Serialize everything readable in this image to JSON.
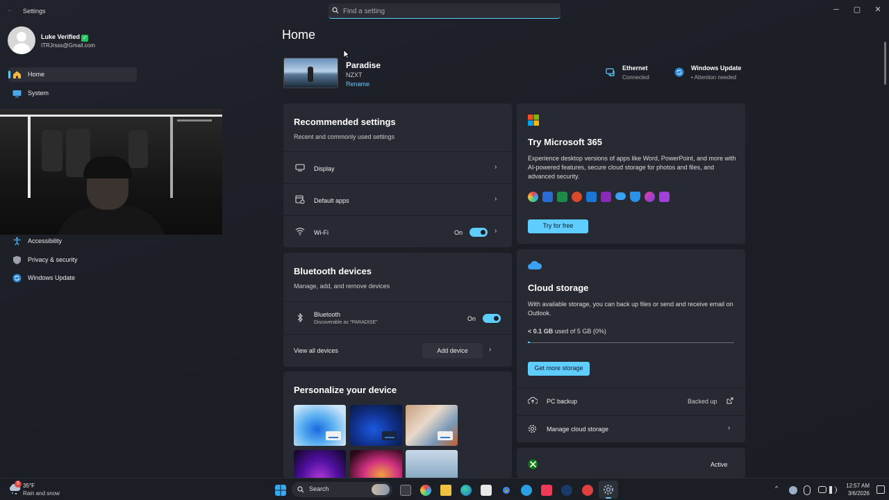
{
  "window": {
    "title": "Settings",
    "minimize_glyph": "─",
    "maximize_glyph": "▢",
    "close_glyph": "✕"
  },
  "search": {
    "placeholder": "Find a setting"
  },
  "user": {
    "name": "Luke Verified",
    "email": "ITRJrsss@Gmail.com",
    "verified_glyph": "✓"
  },
  "sidebar": {
    "items": [
      {
        "label": "Home",
        "icon": "home-icon"
      },
      {
        "label": "System",
        "icon": "system-icon"
      },
      {
        "label": "Accessibility",
        "icon": "accessibility-icon"
      },
      {
        "label": "Privacy & security",
        "icon": "shield-icon"
      },
      {
        "label": "Windows Update",
        "icon": "update-icon"
      }
    ]
  },
  "main": {
    "title": "Home",
    "device": {
      "name": "Paradise",
      "model": "NZXT",
      "rename_label": "Rename"
    },
    "status": {
      "ethernet": {
        "title": "Ethernet",
        "sub": "Connected"
      },
      "update": {
        "title": "Windows Update",
        "sub": "Attention needed"
      }
    },
    "recommended": {
      "title": "Recommended settings",
      "subtitle": "Recent and commonly used settings",
      "rows": [
        {
          "label": "Display",
          "icon": "monitor-icon"
        },
        {
          "label": "Default apps",
          "icon": "default-apps-icon"
        },
        {
          "label": "Wi-Fi",
          "icon": "wifi-icon",
          "state": "On"
        }
      ]
    },
    "bluetooth": {
      "title": "Bluetooth devices",
      "subtitle": "Manage, add, and remove devices",
      "row_title": "Bluetooth",
      "row_sub": "Discoverable as \"PARADISE\"",
      "state": "On",
      "view_all": "View all devices",
      "add_device": "Add device"
    },
    "personalize": {
      "title": "Personalize your device"
    },
    "m365": {
      "title": "Try Microsoft 365",
      "body": "Experience desktop versions of apps like Word, PowerPoint, and more with AI-powered features, secure cloud storage for photos and files, and advanced security.",
      "button": "Try for free"
    },
    "cloud": {
      "title": "Cloud storage",
      "body": "With available storage, you can back up files or send and receive email on Outlook.",
      "usage_bold": "< 0.1 GB",
      "usage_rest": "used of 5 GB (0%)",
      "usage_fraction": 0.01,
      "button": "Get more storage",
      "pc_backup_label": "PC backup",
      "pc_backup_status": "Backed up",
      "manage_label": "Manage cloud storage"
    },
    "xbox": {
      "status": "Active"
    }
  },
  "chevron_glyph": "›",
  "taskbar": {
    "search_label": "Search",
    "weather_badge": "5",
    "weather_temp": "35°F",
    "weather_desc": "Rain and snow",
    "time": "12:57 AM",
    "date": "3/6/2026",
    "tray_up_glyph": "^"
  },
  "colors": {
    "accent": "#60cdff",
    "background": "#1d1f27",
    "card": "#272a32"
  }
}
